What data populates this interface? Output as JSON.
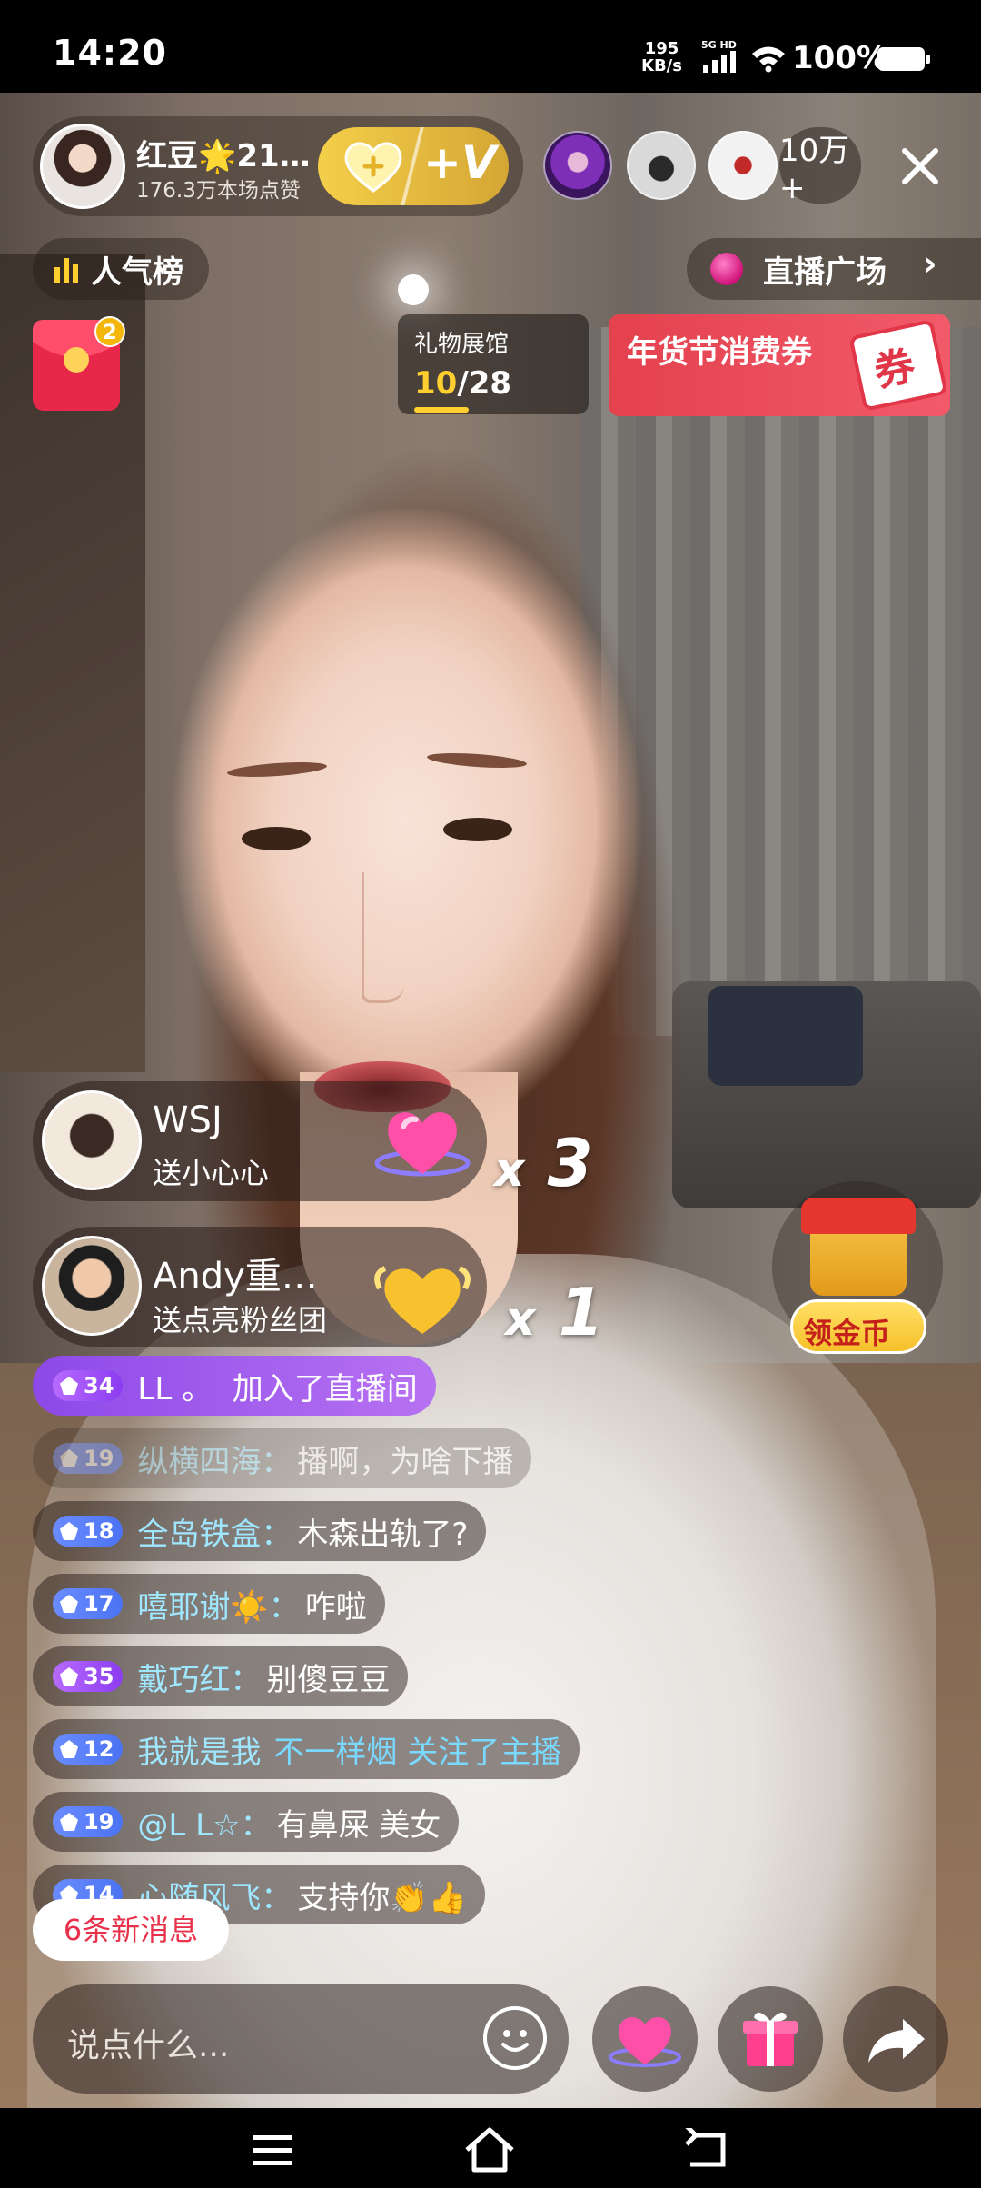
{
  "status_bar": {
    "time": "14:20",
    "net_speed_value": "195",
    "net_speed_unit": "KB/s",
    "network_type": "5G HD",
    "battery": "100%"
  },
  "host": {
    "name": "红豆🌟21…",
    "likes": "176.3万本场点赞",
    "fan_button_label": "+V"
  },
  "viewers": {
    "count": "10万+"
  },
  "top_buttons": {
    "rank_label": "人气榜",
    "plaza_label": "直播广场"
  },
  "red_packet": {
    "badge": "2"
  },
  "gift_hall": {
    "label": "礼物展馆",
    "current": "10",
    "total": "/28"
  },
  "coupon": {
    "label": "年货节消费券",
    "tag": "券"
  },
  "gifts": [
    {
      "user": "WSJ",
      "action": "送小心心",
      "count_prefix": "x",
      "count": "3"
    },
    {
      "user": "Andy重…",
      "action": "送点亮粉丝团",
      "count_prefix": "x",
      "count": "1"
    }
  ],
  "coin": {
    "label": "领金币"
  },
  "chat": {
    "join": {
      "level": "34",
      "user": "LL 。",
      "text": "加入了直播间"
    },
    "messages": [
      {
        "level": "19",
        "user": "纵横四海：",
        "text": "播啊，为啥下播"
      },
      {
        "level": "18",
        "user": "全岛铁盒：",
        "text": "木森出轨了?"
      },
      {
        "level": "17",
        "user": "嘻耶谢☀️：",
        "text": "咋啦"
      },
      {
        "level": "35",
        "user": "戴巧红：",
        "text": "别傻豆豆"
      },
      {
        "level": "12",
        "user": "我就是我",
        "text": "不一样烟 关注了主播"
      },
      {
        "level": "19",
        "user": "@L L☆：",
        "text": "有鼻屎 美女"
      },
      {
        "level": "14",
        "user": "心随风飞：",
        "text": "支持你👏👍"
      }
    ]
  },
  "new_messages_label": "6条新消息",
  "input": {
    "placeholder": "说点什么..."
  },
  "colors": {
    "accent_gold": "#f4cf4a",
    "coupon_red": "#e4414e",
    "level_blue": "#4b73f2",
    "level_purple": "#8b3cf0",
    "new_msg_red": "#e8324b"
  }
}
